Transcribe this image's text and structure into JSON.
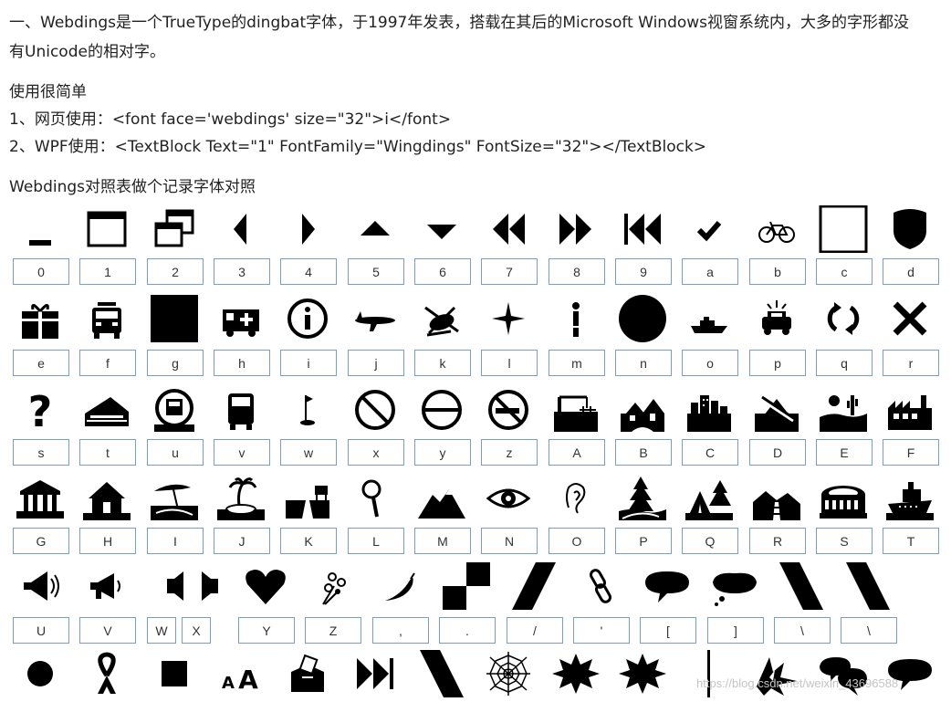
{
  "intro": {
    "line1": "一、Webdings是一个TrueType的dingbat字体，于1997年发表，搭载在其后的Microsoft Windows视窗系统内，大多的字形都没",
    "line2": "有Unicode的相对字。"
  },
  "usage": {
    "heading": "使用很简单",
    "item1": "1、网页使用：<font face='webdings' size=\"32\">i</font>",
    "item2": "2、WPF使用：<TextBlock Text=\"1\" FontFamily=\"Wingdings\" FontSize=\"32\"></TextBlock>"
  },
  "table_title": "Webdings对照表做个记录字体对照",
  "rows": [
    [
      {
        "char": "0",
        "icon": "minimize-icon"
      },
      {
        "char": "1",
        "icon": "maximize-icon"
      },
      {
        "char": "2",
        "icon": "restore-icon"
      },
      {
        "char": "3",
        "icon": "triangle-left-icon"
      },
      {
        "char": "4",
        "icon": "triangle-right-icon"
      },
      {
        "char": "5",
        "icon": "triangle-up-icon"
      },
      {
        "char": "6",
        "icon": "triangle-down-icon"
      },
      {
        "char": "7",
        "icon": "rewind-icon"
      },
      {
        "char": "8",
        "icon": "fast-forward-icon"
      },
      {
        "char": "9",
        "icon": "skip-back-icon"
      },
      {
        "char": "a",
        "icon": "checkmark-icon"
      },
      {
        "char": "b",
        "icon": "bicycle-icon"
      },
      {
        "char": "c",
        "icon": "empty-box-icon"
      },
      {
        "char": "d",
        "icon": "shield-icon"
      }
    ],
    [
      {
        "char": "e",
        "icon": "gift-icon"
      },
      {
        "char": "f",
        "icon": "fire-truck-icon"
      },
      {
        "char": "g",
        "icon": "filled-square-icon"
      },
      {
        "char": "h",
        "icon": "ambulance-icon"
      },
      {
        "char": "i",
        "icon": "info-icon"
      },
      {
        "char": "j",
        "icon": "airplane-icon"
      },
      {
        "char": "k",
        "icon": "helicopter-icon"
      },
      {
        "char": "l",
        "icon": "compass-star-icon"
      },
      {
        "char": "m",
        "icon": "man-icon"
      },
      {
        "char": "n",
        "icon": "filled-circle-icon"
      },
      {
        "char": "o",
        "icon": "ship-icon"
      },
      {
        "char": "p",
        "icon": "police-car-icon"
      },
      {
        "char": "q",
        "icon": "refresh-icon"
      },
      {
        "char": "r",
        "icon": "close-x-icon"
      }
    ],
    [
      {
        "char": "s",
        "icon": "question-icon"
      },
      {
        "char": "t",
        "icon": "train-icon"
      },
      {
        "char": "u",
        "icon": "subway-icon"
      },
      {
        "char": "v",
        "icon": "bus-icon"
      },
      {
        "char": "w",
        "icon": "golf-flag-icon"
      },
      {
        "char": "x",
        "icon": "prohibited-icon"
      },
      {
        "char": "y",
        "icon": "no-entry-icon"
      },
      {
        "char": "z",
        "icon": "no-smoking-icon"
      },
      {
        "char": "A",
        "icon": "construction-icon"
      },
      {
        "char": "B",
        "icon": "houses-icon"
      },
      {
        "char": "C",
        "icon": "city-icon"
      },
      {
        "char": "D",
        "icon": "derelict-house-icon"
      },
      {
        "char": "E",
        "icon": "desert-icon"
      },
      {
        "char": "F",
        "icon": "factory-icon"
      }
    ],
    [
      {
        "char": "G",
        "icon": "government-building-icon"
      },
      {
        "char": "H",
        "icon": "home-icon"
      },
      {
        "char": "I",
        "icon": "beach-icon"
      },
      {
        "char": "J",
        "icon": "island-icon"
      },
      {
        "char": "K",
        "icon": "motorway-icon"
      },
      {
        "char": "L",
        "icon": "magnifier-icon"
      },
      {
        "char": "M",
        "icon": "mountain-icon"
      },
      {
        "char": "N",
        "icon": "eye-icon"
      },
      {
        "char": "O",
        "icon": "ear-icon"
      },
      {
        "char": "P",
        "icon": "forest-icon"
      },
      {
        "char": "Q",
        "icon": "camping-icon"
      },
      {
        "char": "R",
        "icon": "railway-icon"
      },
      {
        "char": "S",
        "icon": "stadium-icon"
      },
      {
        "char": "T",
        "icon": "cruise-ship-icon"
      }
    ],
    [
      {
        "char": "U",
        "icon": "loudspeaker-icon"
      },
      {
        "char": "V",
        "icon": "megaphone-icon"
      },
      {
        "char": "W",
        "icon": "speaker-left-icon"
      },
      {
        "char": "X",
        "icon": "speaker-right-icon"
      },
      {
        "char": "Y",
        "icon": "heart-icon"
      },
      {
        "char": "Z",
        "icon": "bouquet-icon"
      },
      {
        "char": ",",
        "icon": "chili-pepper-icon"
      },
      {
        "char": ".",
        "icon": "checker-steps-icon"
      },
      {
        "char": "/",
        "icon": "slash-band-icon"
      },
      {
        "char": "'",
        "icon": "chain-link-icon"
      },
      {
        "char": "[",
        "icon": "speech-bubble-icon"
      },
      {
        "char": "]",
        "icon": "thought-bubble-icon"
      },
      {
        "char": "\\",
        "icon": "backslash-band-icon"
      },
      {
        "char": "\\",
        "icon": "backslash-band-icon"
      }
    ],
    [
      {
        "char": "",
        "icon": "dot-icon"
      },
      {
        "char": "",
        "icon": "ribbon-icon"
      },
      {
        "char": "",
        "icon": "small-square-icon"
      },
      {
        "char": "",
        "icon": "font-size-icon"
      },
      {
        "char": "",
        "icon": "ballot-box-icon"
      },
      {
        "char": "",
        "icon": "skip-forward-icon"
      },
      {
        "char": "",
        "icon": "backslash-band-icon"
      },
      {
        "char": "",
        "icon": "spider-web-icon"
      },
      {
        "char": "",
        "icon": "starburst-icon"
      },
      {
        "char": "",
        "icon": "starburst-icon"
      },
      {
        "char": "",
        "icon": "vertical-bar-icon"
      },
      {
        "char": "",
        "icon": "explosion-icon"
      },
      {
        "char": "",
        "icon": "chat-bubbles-icon"
      },
      {
        "char": "",
        "icon": "speech-bubble-icon"
      }
    ]
  ],
  "watermark": "https://blog.csdn.net/weixin_43696588"
}
